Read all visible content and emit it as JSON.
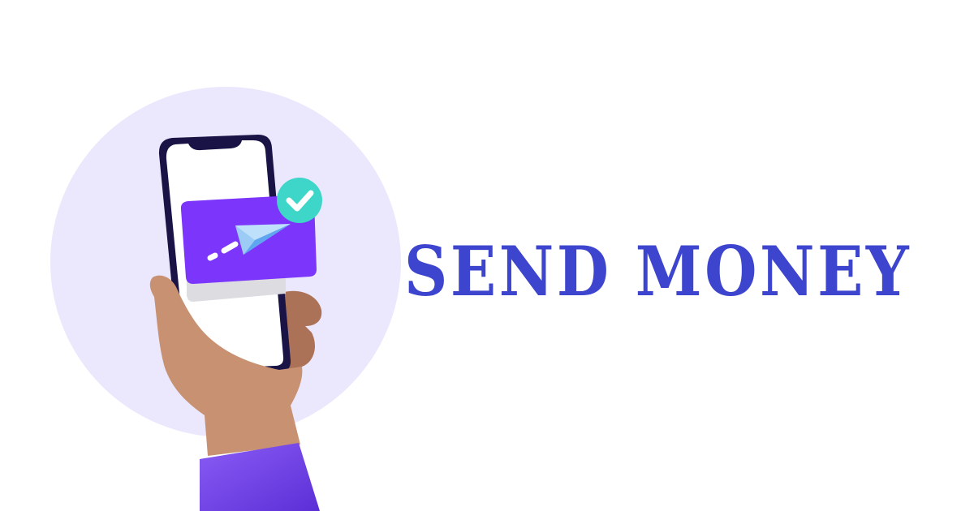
{
  "headline": {
    "text": "SEND MONEY",
    "color": "#3d45cf"
  },
  "illustration": {
    "subject": "hand-holding-phone-with-paper-plane-card",
    "icons": [
      "paper-plane-icon",
      "check-icon"
    ],
    "colors": {
      "circle": "#ebe7fd",
      "phone_frame": "#1a1446",
      "phone_screen": "#ffffff",
      "card": "#7b35fb",
      "card_shadow": "#dcdce1",
      "check_badge": "#3dd6c8",
      "plane_light": "#bfe0fb",
      "plane_dark": "#5ea6f0",
      "skin": "#c79172",
      "skin_shadow": "#ab7258",
      "sleeve": "#6b3df0"
    }
  }
}
